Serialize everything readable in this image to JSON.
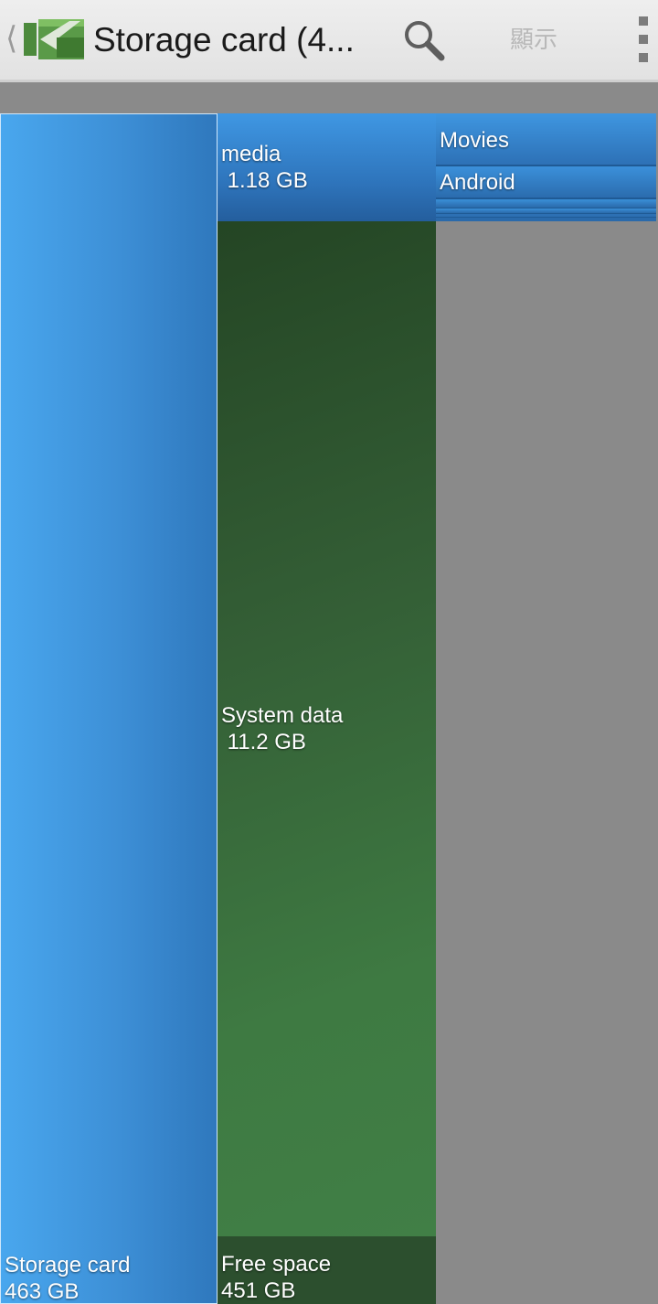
{
  "actionbar": {
    "title": "Storage card (4...",
    "display_label": "顯示",
    "icons": {
      "up": "chevron-left-icon",
      "logo": "app-logo-icon",
      "search": "search-icon",
      "overflow": "overflow-menu-icon"
    }
  },
  "treemap": {
    "root": {
      "name": "Storage card",
      "size": "463 GB"
    },
    "children": [
      {
        "name": "media",
        "size": " 1.18 GB"
      },
      {
        "name": "System data",
        "size": " 11.2 GB"
      },
      {
        "name": "Free space",
        "size": "451 GB"
      }
    ],
    "media_children": [
      {
        "name": "Movies"
      },
      {
        "name": "Android"
      }
    ],
    "colors": {
      "storage": "#3d8fd6",
      "media": "#2e74bb",
      "system": "#345f36",
      "free": "#2c4f2e",
      "background": "#8a8a8a"
    }
  }
}
